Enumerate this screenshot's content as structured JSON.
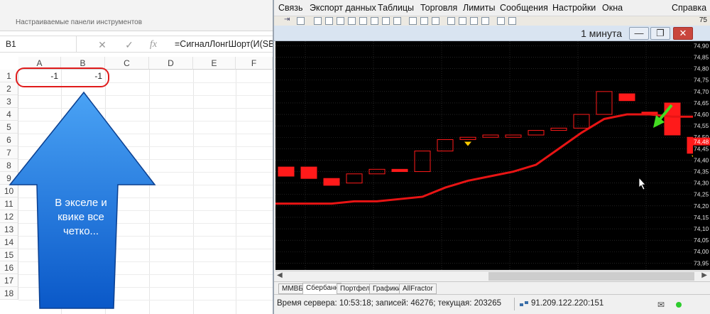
{
  "excel": {
    "ribbon_label": "Настраиваемые панели инструментов",
    "name_box": "B1",
    "formula": "=СигналЛонгШорт(И(SB",
    "fx_cancel": "✕",
    "fx_enter": "✓",
    "fx_label": "fx",
    "columns": [
      "A",
      "B",
      "C",
      "D",
      "E",
      "F"
    ],
    "rows": [
      "1",
      "2",
      "3",
      "4",
      "5",
      "6",
      "7",
      "8",
      "9",
      "10",
      "11",
      "12",
      "13",
      "14",
      "15",
      "16",
      "17",
      "18"
    ],
    "cells": {
      "A1": "-1",
      "B1": "-1"
    },
    "arrow_text_line1": "В экселе и",
    "arrow_text_line2": "квике все",
    "arrow_text_line3": "четко..."
  },
  "quik": {
    "menu": [
      "Связь",
      "Экспорт данных",
      "Таблицы",
      "Торговля",
      "Лимиты",
      "Сообщения",
      "Настройки",
      "Окна",
      "Справка"
    ],
    "toolbar_number": "75",
    "chart_title": "1 минута",
    "window_buttons": {
      "minimize": "—",
      "restore": "❐",
      "close": "✕"
    },
    "price_labels": [
      "74,90",
      "74,85",
      "74,80",
      "74,75",
      "74,70",
      "74,65",
      "74,60",
      "74,55",
      "74,50",
      "74,45",
      "74,40",
      "74,35",
      "74,30",
      "74,25",
      "74,20",
      "74,15",
      "74,10",
      "74,05",
      "74,00",
      "73,95"
    ],
    "current_price_label": "74,48",
    "tabs": [
      "ММВБ",
      "Сбербанк",
      "Портфель",
      "Графики",
      "AllFractor"
    ],
    "active_tab": "Сбербанк",
    "status": {
      "server_time_text": "Время сервера: 10:53:18; записей: 46276; текущая: 203265",
      "server_ip": "91.209.122.220:151"
    },
    "colors": {
      "candle": "#ff1a1a",
      "line": "#e81414",
      "signal": "#ffcc00",
      "arrow": "#44dd22",
      "grid": "#3a3a3a"
    }
  },
  "chart_data": {
    "type": "line",
    "title": "1 минута",
    "ylim": [
      73.92,
      74.92
    ],
    "candles": [
      {
        "open": 74.37,
        "close": 74.33
      },
      {
        "open": 74.37,
        "close": 74.32
      },
      {
        "open": 74.32,
        "close": 74.29
      },
      {
        "open": 74.3,
        "close": 74.34
      },
      {
        "open": 74.34,
        "close": 74.36
      },
      {
        "open": 74.36,
        "close": 74.35
      },
      {
        "open": 74.35,
        "close": 74.44
      },
      {
        "open": 74.44,
        "close": 74.49
      },
      {
        "open": 74.49,
        "close": 74.5
      },
      {
        "open": 74.5,
        "close": 74.51
      },
      {
        "open": 74.5,
        "close": 74.51
      },
      {
        "open": 74.51,
        "close": 74.53
      },
      {
        "open": 74.53,
        "close": 74.54
      },
      {
        "open": 74.54,
        "close": 74.6
      },
      {
        "open": 74.6,
        "close": 74.7
      },
      {
        "open": 74.69,
        "close": 74.66
      },
      {
        "open": 74.61,
        "close": 74.6
      },
      {
        "open": 74.65,
        "close": 74.51
      },
      {
        "open": 74.5,
        "close": 74.43
      }
    ],
    "line": [
      74.21,
      74.21,
      74.21,
      74.22,
      74.22,
      74.23,
      74.24,
      74.28,
      74.31,
      74.33,
      74.35,
      74.38,
      74.45,
      74.52,
      74.58,
      74.6,
      74.6,
      74.59,
      74.59
    ],
    "signals": [
      8,
      18
    ]
  }
}
